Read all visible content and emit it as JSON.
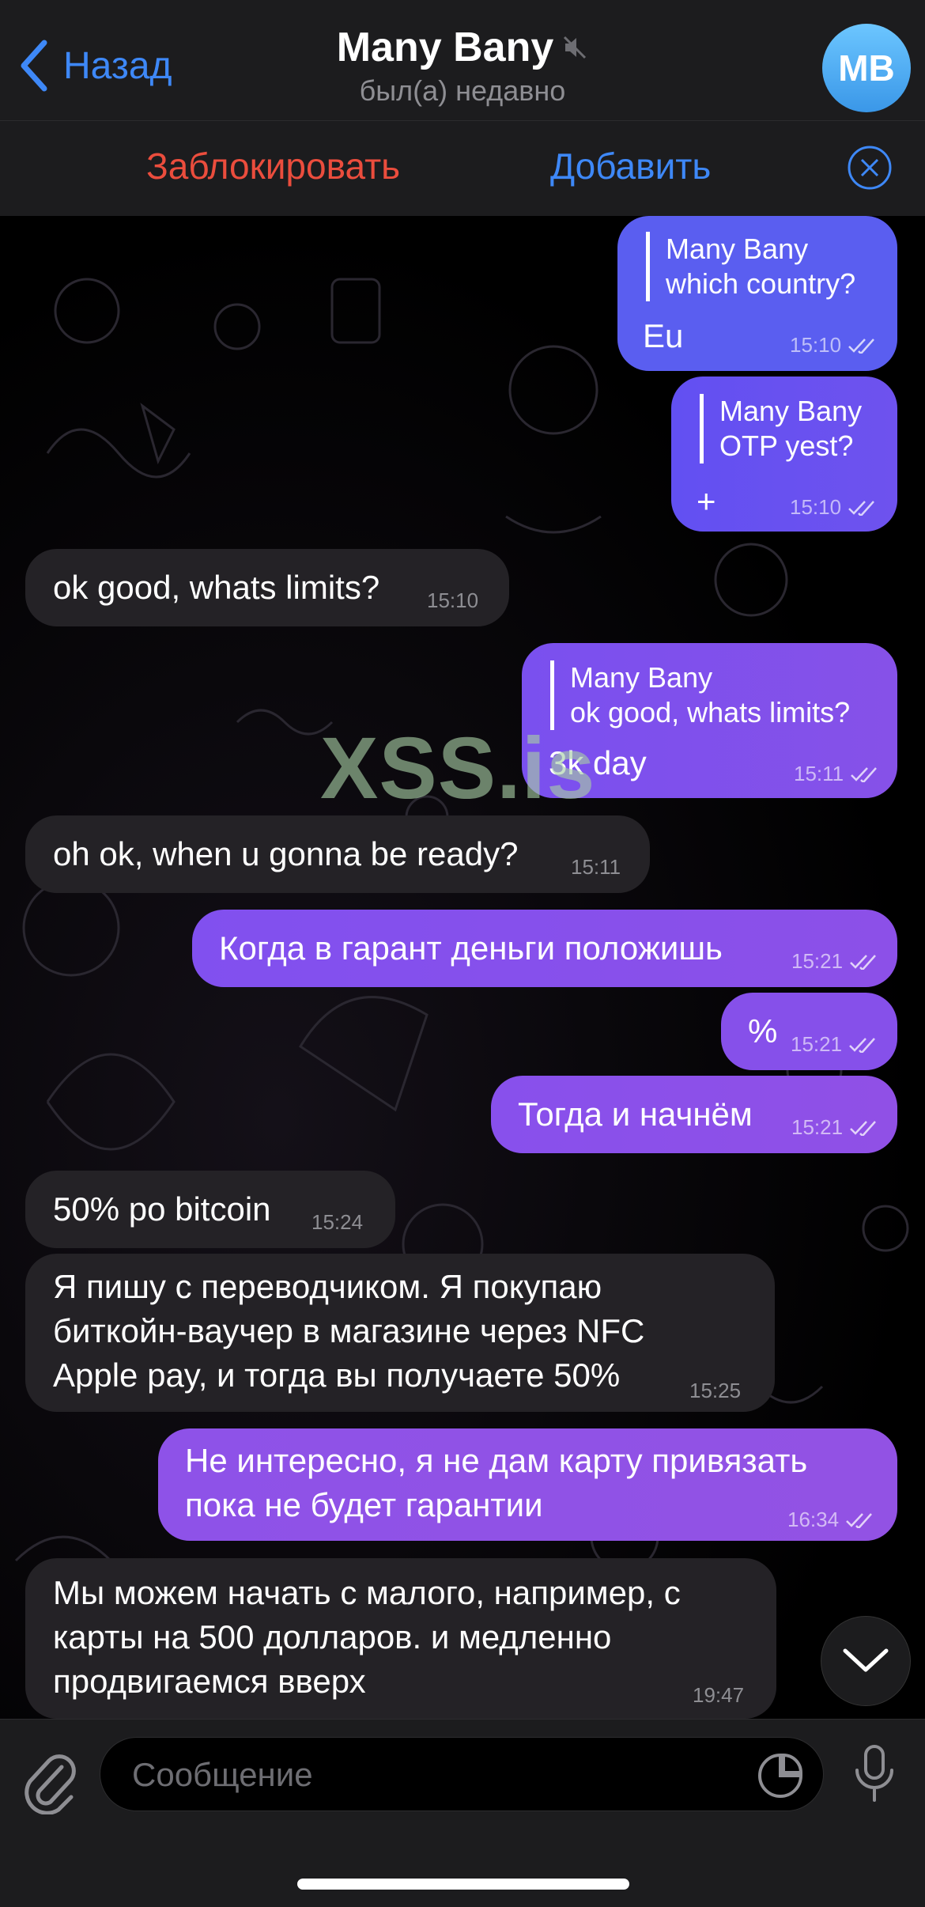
{
  "header": {
    "back_label": "Назад",
    "title": "Many Bany",
    "subtitle": "был(а) недавно",
    "avatar_initials": "MB"
  },
  "actions": {
    "block_label": "Заблокировать",
    "add_label": "Добавить"
  },
  "watermark": "XSS.is",
  "messages": [
    {
      "dir": "out",
      "reply_name": "Many Bany",
      "reply_text": "which country?",
      "text": "Eu",
      "time": "15:10"
    },
    {
      "dir": "out",
      "reply_name": "Many Bany",
      "reply_text": "OTP yest?",
      "text": "+",
      "time": "15:10"
    },
    {
      "dir": "in",
      "text": "ok good, whats limits?",
      "time": "15:10"
    },
    {
      "dir": "out",
      "reply_name": "Many Bany",
      "reply_text": "ok good, whats limits?",
      "text": "3k day",
      "time": "15:11"
    },
    {
      "dir": "in",
      "text": "oh ok, when u gonna be ready?",
      "time": "15:11"
    },
    {
      "dir": "out",
      "text": "Когда в гарант деньги положишь",
      "time": "15:21"
    },
    {
      "dir": "out",
      "text": "%",
      "time": "15:21"
    },
    {
      "dir": "out",
      "text": "Тогда и начнём",
      "time": "15:21"
    },
    {
      "dir": "in",
      "text": "50% po bitcoin",
      "time": "15:24"
    },
    {
      "dir": "in",
      "lines": [
        "Я пишу с переводчиком. Я покупаю",
        "биткойн-ваучер в магазине через NFC",
        "Apple pay, и тогда вы получаете 50%"
      ],
      "time": "15:25"
    },
    {
      "dir": "out",
      "lines": [
        "Не интересно, я не дам карту привязать",
        "пока не будет гарантии"
      ],
      "time": "16:34"
    },
    {
      "dir": "in",
      "lines": [
        "Мы можем начать с малого, например, с",
        "карты на 500 долларов. и медленно",
        "продвигаемся вверх"
      ],
      "time": "19:47"
    }
  ],
  "composer": {
    "placeholder": "Сообщение"
  },
  "colors": {
    "accent": "#3e88f7",
    "danger": "#eb4d3d",
    "outgoing_bubble": "#7b52ee",
    "incoming_bubble": "#242226"
  },
  "icons": [
    "chevron-left-icon",
    "mute-icon",
    "close-icon",
    "double-check-icon",
    "chevron-down-icon",
    "paperclip-icon",
    "sticker-icon",
    "microphone-icon"
  ]
}
